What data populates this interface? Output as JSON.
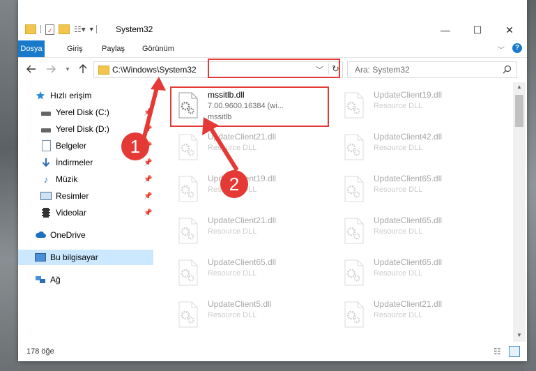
{
  "window": {
    "title": "System32",
    "controls": {
      "minimize": "—",
      "maximize": "☐",
      "close": "✕"
    }
  },
  "ribbon": {
    "tabs": [
      "Dosya",
      "Giriş",
      "Paylaş",
      "Görünüm"
    ]
  },
  "navigation": {
    "address": "C:\\Windows\\System32",
    "search_placeholder": "Ara: System32"
  },
  "sidebar": {
    "items": [
      {
        "label": "Hızlı erişim",
        "icon": "star-icon"
      },
      {
        "label": "Yerel Disk (C:)",
        "icon": "drive-icon",
        "pinned": true
      },
      {
        "label": "Yerel Disk (D:)",
        "icon": "drive-icon",
        "pinned": true
      },
      {
        "label": "Belgeler",
        "icon": "documents-icon",
        "pinned": true
      },
      {
        "label": "İndirmeler",
        "icon": "download-icon",
        "pinned": true
      },
      {
        "label": "Müzik",
        "icon": "music-icon",
        "pinned": true
      },
      {
        "label": "Resimler",
        "icon": "pictures-icon",
        "pinned": true
      },
      {
        "label": "Videolar",
        "icon": "videos-icon",
        "pinned": true
      },
      {
        "label": "OneDrive",
        "icon": "cloud-icon"
      },
      {
        "label": "Bu bilgisayar",
        "icon": "computer-icon",
        "selected": true
      },
      {
        "label": "Ağ",
        "icon": "network-icon"
      }
    ]
  },
  "files": [
    {
      "name": "mssitlb.dll",
      "line2": "7.00.9600.16384 (wi...",
      "line3": "mssitlb",
      "highlighted": true
    },
    {
      "name": "UpdateClient19.dll",
      "line2": "Resource DLL"
    },
    {
      "name": "UpdateClient21.dll",
      "line2": "Resource DLL"
    },
    {
      "name": "UpdateClient42.dll",
      "line2": "Resource DLL"
    },
    {
      "name": "UpdateClient19.dll",
      "line2": "Resource DLL"
    },
    {
      "name": "UpdateClient65.dll",
      "line2": "Resource DLL"
    },
    {
      "name": "UpdateClient21.dll",
      "line2": "Resource DLL"
    },
    {
      "name": "UpdateClient65.dll",
      "line2": "Resource DLL"
    },
    {
      "name": "UpdateClient65.dll",
      "line2": "Resource DLL"
    },
    {
      "name": "UpdateClient65.dll",
      "line2": "Resource DLL"
    },
    {
      "name": "UpdateClient5.dll",
      "line2": "Resource DLL"
    },
    {
      "name": "UpdateClient21.dll",
      "line2": "Resource DLL"
    }
  ],
  "status": {
    "count": "178 öğe"
  },
  "annotations": {
    "callout_1": "1",
    "callout_2": "2",
    "color": "#e53935"
  },
  "colors": {
    "accent": "#1979ca",
    "selected_bg": "#cce8ff"
  }
}
